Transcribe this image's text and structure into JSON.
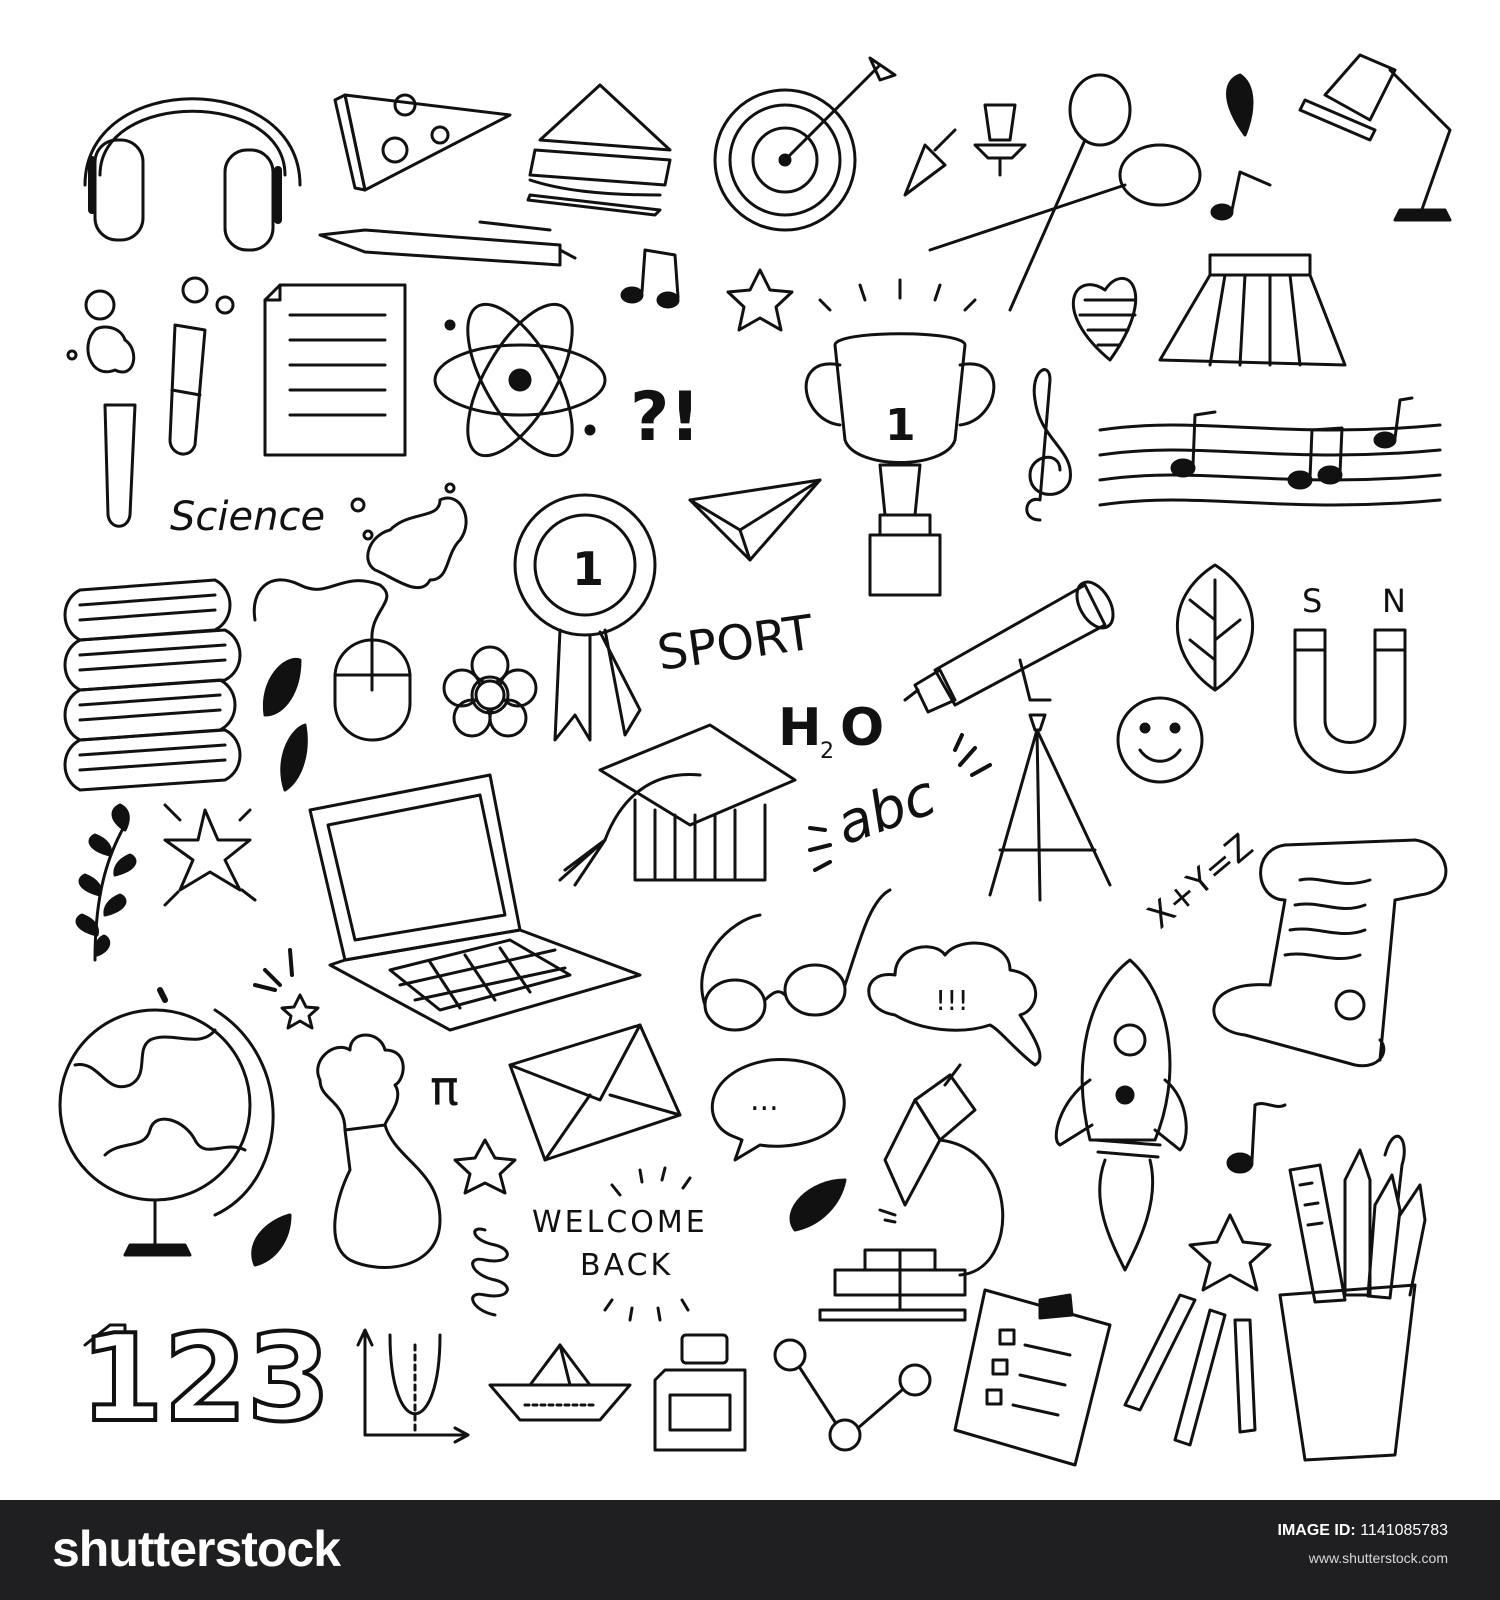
{
  "doodles": {
    "science_text": "Science",
    "question_exclaim": "?!",
    "trophy_number": "1",
    "medal_number": "1",
    "sport_text": "SPORT",
    "h2o_h": "H",
    "h2o_sub": "2",
    "h2o_o": "O",
    "abc_text": "abc",
    "magnet_s": "S",
    "magnet_n": "N",
    "equation": "X+Y=Z",
    "cloud_text": "!!!",
    "speech_text": "...",
    "pi_symbol": "π",
    "welcome_line1": "WELCOME",
    "welcome_line2": "BACK",
    "numbers": "123"
  },
  "footer": {
    "logo": "shutterstock",
    "image_id_label": "IMAGE ID:",
    "image_id_value": "1141085783",
    "site": "www.shutterstock.com"
  },
  "colors": {
    "ink": "#111111",
    "background": "#ffffff",
    "footer_bg": "#1f1f21"
  }
}
